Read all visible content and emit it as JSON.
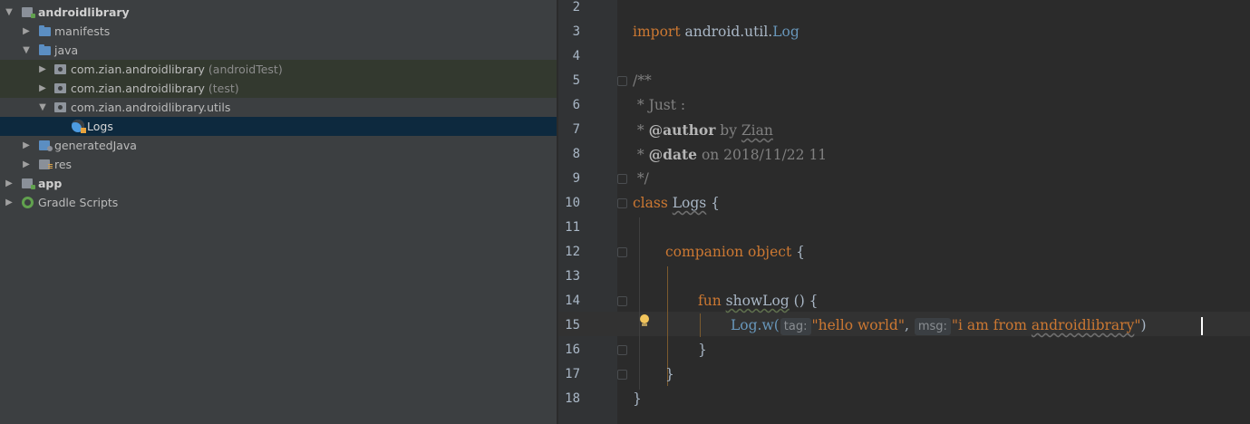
{
  "project_tree": {
    "items": [
      {
        "label": "androidlibrary",
        "suffix": "",
        "icon": "module-folder-icon"
      },
      {
        "label": "manifests",
        "suffix": "",
        "icon": "folder-icon"
      },
      {
        "label": "java",
        "suffix": "",
        "icon": "folder-icon"
      },
      {
        "label": "com.zian.androidlibrary",
        "suffix": "(androidTest)",
        "icon": "package-icon"
      },
      {
        "label": "com.zian.androidlibrary",
        "suffix": "(test)",
        "icon": "package-icon"
      },
      {
        "label": "com.zian.androidlibrary.utils",
        "suffix": "",
        "icon": "package-icon"
      },
      {
        "label": "Logs",
        "suffix": "",
        "icon": "kotlin-class-icon"
      },
      {
        "label": "generatedJava",
        "suffix": "",
        "icon": "generated-folder-icon"
      },
      {
        "label": "res",
        "suffix": "",
        "icon": "resources-folder-icon"
      },
      {
        "label": "app",
        "suffix": "",
        "icon": "module-folder-icon"
      },
      {
        "label": "Gradle Scripts",
        "suffix": "",
        "icon": "gradle-icon"
      }
    ]
  },
  "editor": {
    "line_numbers": [
      "2",
      "3",
      "4",
      "5",
      "6",
      "7",
      "8",
      "9",
      "10",
      "11",
      "12",
      "13",
      "14",
      "15",
      "16",
      "17",
      "18"
    ],
    "code": {
      "l3_import": "import",
      "l3_pkg": " android.util.",
      "l3_log": "Log",
      "l5": "/**",
      "l6": " * Just :",
      "l7_star": " * ",
      "l7_tag": "@author",
      "l7_by": " by ",
      "l7_name": "Zian",
      "l8_star": " * ",
      "l8_tag": "@date",
      "l8_rest": " on 2018/11/22 11",
      "l9": " */",
      "l10_kw": "class",
      "l10_name": "Logs",
      "l10_brace": " {",
      "l12_kw": "companion object",
      "l12_brace": " {",
      "l14_kw": "fun",
      "l14_name": "showLog",
      "l14_rest": " () {",
      "l15_log": "Log",
      "l15_w": ".w(",
      "l15_hint_tag": "tag:",
      "l15_str1": "\"hello world\"",
      "l15_comma": ", ",
      "l15_hint_msg": "msg:",
      "l15_str2a": "\"i am from ",
      "l15_str2b": "androidlibrary",
      "l15_str2c": "\"",
      "l15_paren": ")",
      "l16": "}",
      "l17": "}",
      "l18": "}"
    }
  }
}
